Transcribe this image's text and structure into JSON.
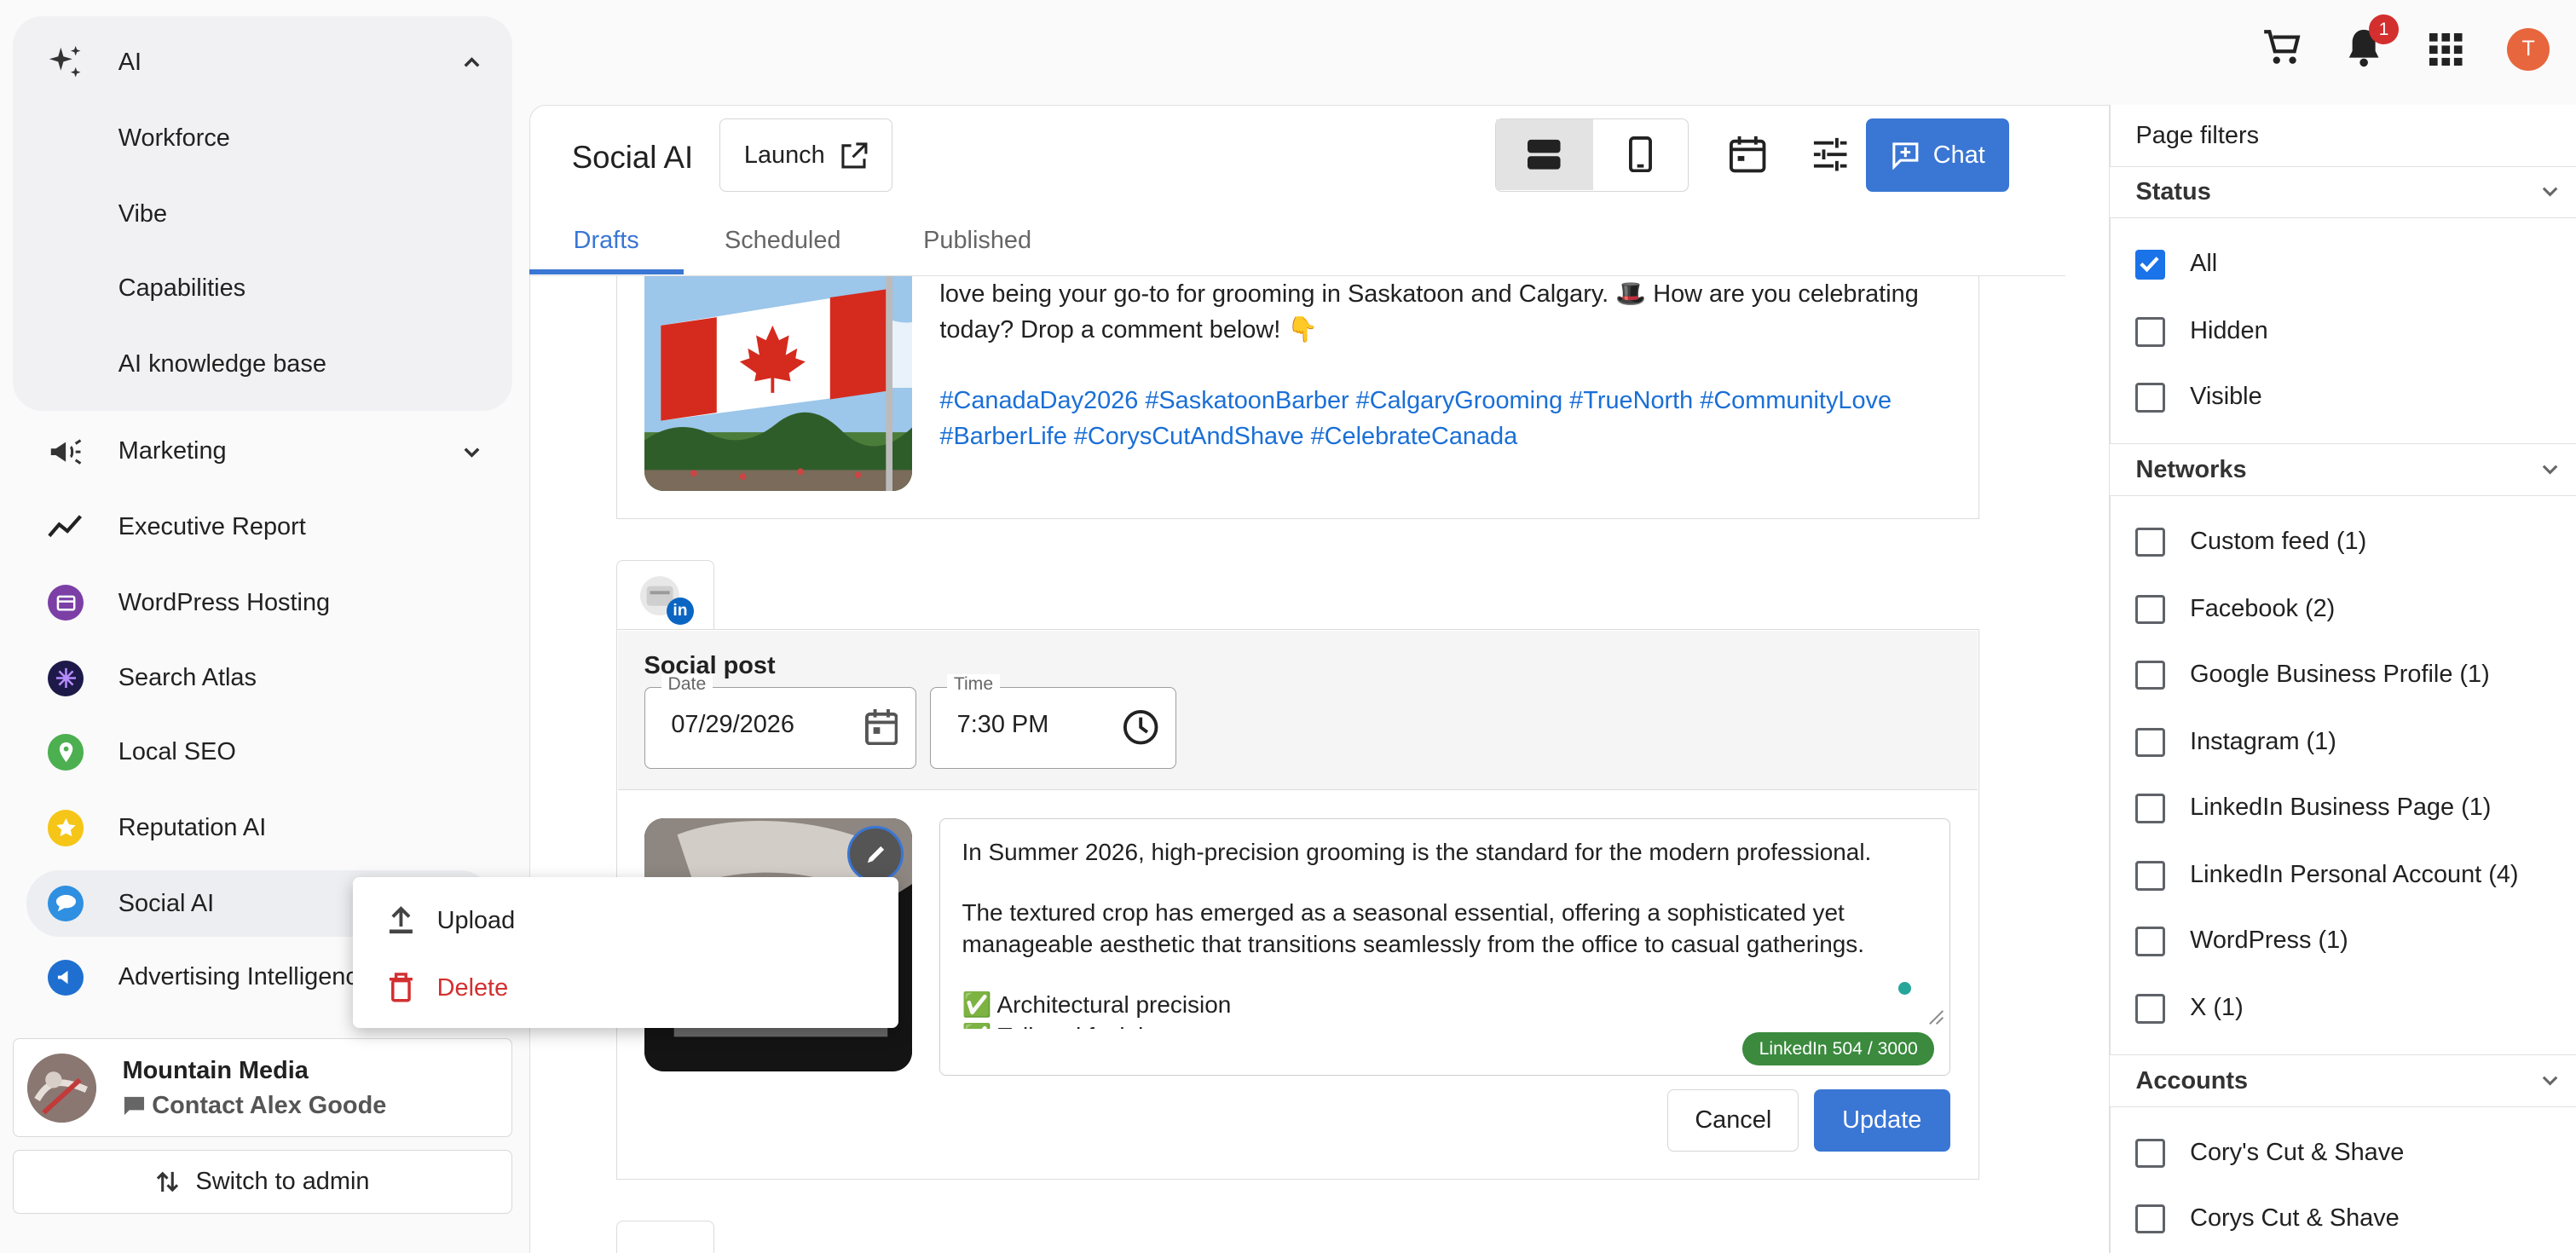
{
  "sidebar": {
    "ai_group": {
      "label": "AI",
      "items": [
        "Workforce",
        "Vibe",
        "Capabilities",
        "AI knowledge base"
      ]
    },
    "items": [
      {
        "label": "Marketing",
        "icon": "megaphone-icon"
      },
      {
        "label": "Executive Report",
        "icon": "trend-line-icon"
      },
      {
        "label": "WordPress Hosting",
        "icon": "wordpress-hosting-icon"
      },
      {
        "label": "Search Atlas",
        "icon": "search-atlas-icon"
      },
      {
        "label": "Local SEO",
        "icon": "map-pin-icon"
      },
      {
        "label": "Reputation AI",
        "icon": "star-icon"
      },
      {
        "label": "Social AI",
        "icon": "social-ai-icon"
      },
      {
        "label": "Advertising Intelligence",
        "icon": "advertising-icon"
      }
    ],
    "account": {
      "name": "Mountain Media",
      "contact": "Contact Alex Goode"
    },
    "switch_label": "Switch to admin"
  },
  "header": {
    "notification_count": "1",
    "avatar_initial": "T"
  },
  "page": {
    "title": "Social AI",
    "launch_label": "Launch",
    "chat_label": "Chat",
    "tabs": [
      "Drafts",
      "Scheduled",
      "Published"
    ],
    "active_tab": "Drafts"
  },
  "post1": {
    "text": "love being your go-to for grooming in Saskatoon and Calgary. 🎩 How are you celebrating today? Drop a comment below! 👇",
    "hashtags": "#CanadaDay2026 #SaskatoonBarber #CalgaryGrooming #TrueNorth #CommunityLove #BarberLife #CorysCutAndShave #CelebrateCanada"
  },
  "post2": {
    "heading": "Social post",
    "date_legend": "Date",
    "date_value": "07/29/2026",
    "time_legend": "Time",
    "time_value": "7:30 PM",
    "text_line1": "In Summer 2026, high-precision grooming is the standard for the modern professional.",
    "text_line2": "The textured crop has emerged as a seasonal essential, offering a sophisticated yet manageable aesthetic that transitions seamlessly from the office to casual gatherings.",
    "text_line3": "✅ Architectural precision",
    "text_line4": "✅ Tailored facial symmetry",
    "counter": "LinkedIn 504 / 3000",
    "cancel_label": "Cancel",
    "update_label": "Update"
  },
  "context_menu": {
    "upload_label": "Upload",
    "delete_label": "Delete"
  },
  "filters": {
    "title": "Page filters",
    "status": {
      "title": "Status",
      "options": [
        "All",
        "Hidden",
        "Visible"
      ],
      "checked": "All"
    },
    "networks": {
      "title": "Networks",
      "options": [
        "Custom feed (1)",
        "Facebook (2)",
        "Google Business Profile (1)",
        "Instagram (1)",
        "LinkedIn Business Page (1)",
        "LinkedIn Personal Account (4)",
        "WordPress (1)",
        "X (1)"
      ]
    },
    "accounts": {
      "title": "Accounts",
      "options": [
        "Cory's Cut & Shave",
        "Corys Cut & Shave"
      ]
    }
  },
  "colors": {
    "primary": "#3a76d4",
    "danger": "#d32f2f",
    "success": "#3b8a3e",
    "hashtag": "#1a6fd6"
  }
}
